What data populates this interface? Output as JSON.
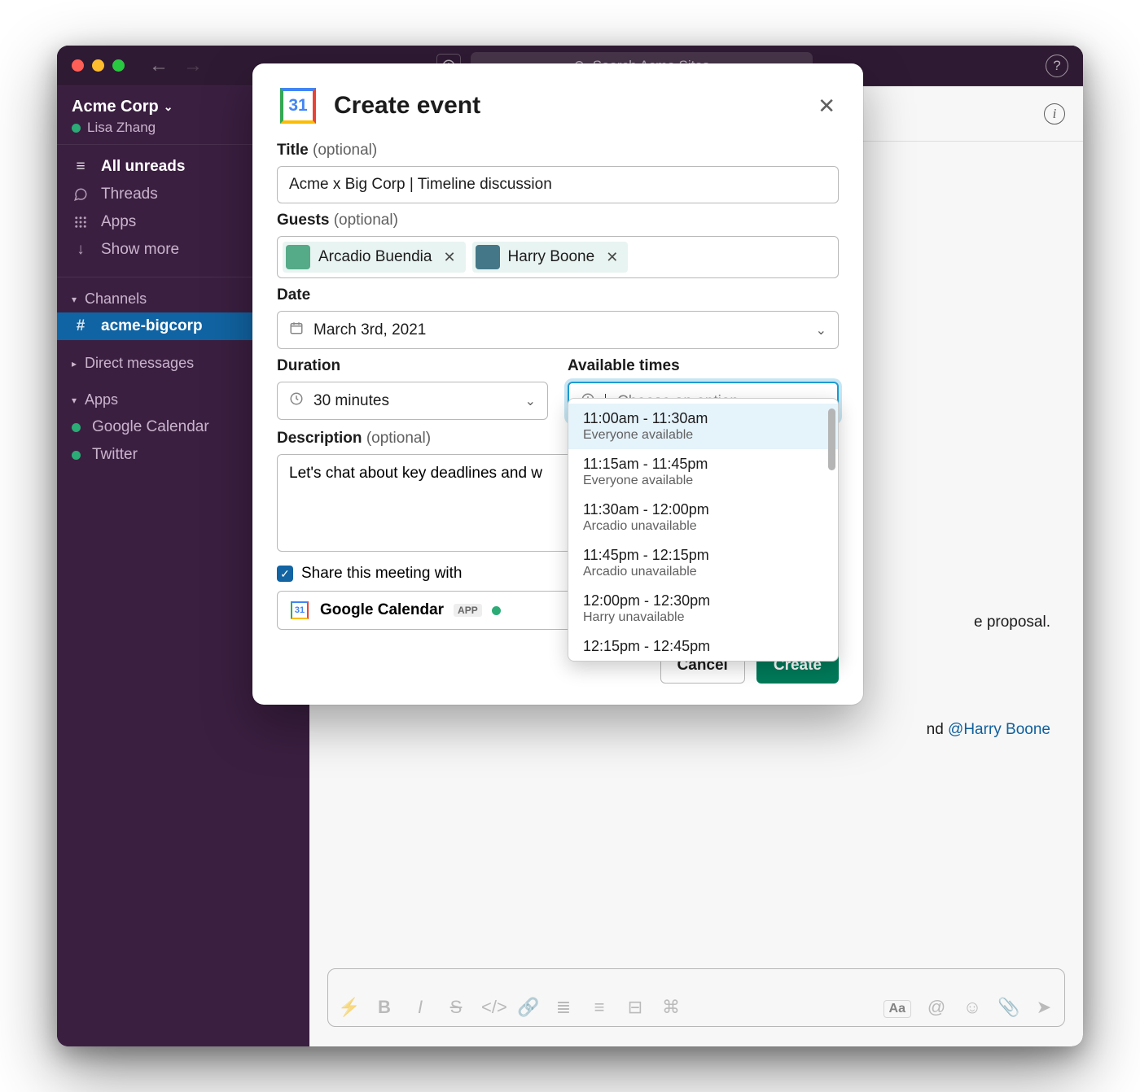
{
  "titlebar": {
    "search_placeholder": "Search Acme Sites"
  },
  "workspace": {
    "name": "Acme Corp",
    "user_name": "Lisa Zhang"
  },
  "sidebar": {
    "all_unreads": "All unreads",
    "threads": "Threads",
    "apps": "Apps",
    "show_more": "Show more",
    "channels_header": "Channels",
    "channels": [
      {
        "name": "acme-bigcorp",
        "prefix": "#"
      }
    ],
    "dms_header": "Direct messages",
    "apps_header": "Apps",
    "app_items": [
      {
        "name": "Google Calendar"
      },
      {
        "name": "Twitter"
      }
    ]
  },
  "conversation": {
    "snippet_tail": "e proposal.",
    "mention_prefix": "nd ",
    "mention": "@Harry Boone"
  },
  "modal": {
    "title": "Create event",
    "calendar_day": "31",
    "title_field": {
      "label": "Title",
      "optional": "(optional)",
      "value": "Acme x Big Corp | Timeline discussion"
    },
    "guests_field": {
      "label": "Guests",
      "optional": "(optional)",
      "chips": [
        {
          "name": "Arcadio Buendia"
        },
        {
          "name": "Harry Boone"
        }
      ]
    },
    "date_field": {
      "label": "Date",
      "value": "March 3rd, 2021"
    },
    "duration_field": {
      "label": "Duration",
      "value": "30 minutes"
    },
    "available_field": {
      "label": "Available times",
      "placeholder": "Choose an option...",
      "options": [
        {
          "range": "11:00am - 11:30am",
          "sub": "Everyone available"
        },
        {
          "range": "11:15am - 11:45pm",
          "sub": "Everyone available"
        },
        {
          "range": "11:30am - 12:00pm",
          "sub": "Arcadio unavailable"
        },
        {
          "range": "11:45pm - 12:15pm",
          "sub": "Arcadio unavailable"
        },
        {
          "range": "12:00pm - 12:30pm",
          "sub": "Harry unavailable"
        },
        {
          "range": "12:15pm - 12:45pm",
          "sub": ""
        }
      ]
    },
    "description_field": {
      "label": "Description",
      "optional": "(optional)",
      "value": "Let's chat about key deadlines and w"
    },
    "share": {
      "label": "Share this meeting with",
      "target": "Google Calendar",
      "badge": "APP"
    },
    "buttons": {
      "cancel": "Cancel",
      "create": "Create"
    }
  },
  "composer": {
    "aa": "Aa"
  }
}
